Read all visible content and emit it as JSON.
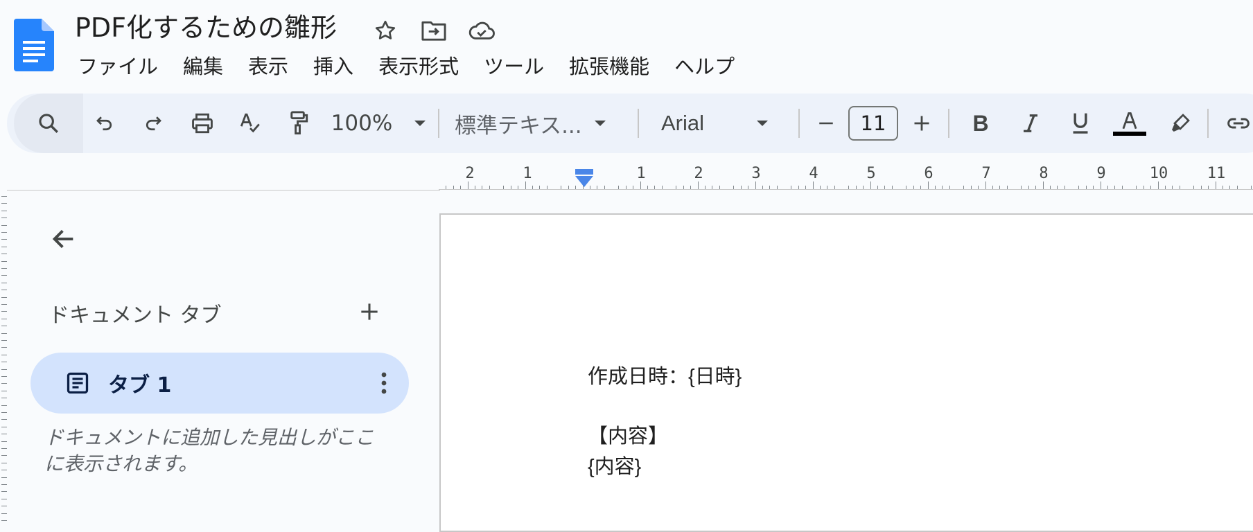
{
  "app": {
    "title": "PDF化するための雛形",
    "brand_color": "#1a73e8"
  },
  "menu": [
    "ファイル",
    "編集",
    "表示",
    "挿入",
    "表示形式",
    "ツール",
    "拡張機能",
    "ヘルプ"
  ],
  "toolbar": {
    "zoom": "100%",
    "paragraph_style": "標準テキス...",
    "font": "Arial",
    "font_size": "11",
    "icons": [
      "search-icon",
      "undo-icon",
      "redo-icon",
      "print-icon",
      "spellcheck-icon",
      "paint-format-icon",
      "bold-icon",
      "italic-icon",
      "underline-icon",
      "text-color-icon",
      "highlight-icon",
      "link-icon"
    ]
  },
  "ruler": {
    "labels": [
      "2",
      "1",
      "1",
      "2",
      "3",
      "4",
      "5",
      "6",
      "7",
      "8",
      "9",
      "10",
      "11"
    ]
  },
  "sidebar": {
    "heading": "ドキュメント タブ",
    "tab_label": "タブ 1",
    "hint": "ドキュメントに追加した見出しがここに表示されます。"
  },
  "document": {
    "lines": [
      "作成日時：{日時}",
      "【内容】",
      "{内容}"
    ]
  }
}
